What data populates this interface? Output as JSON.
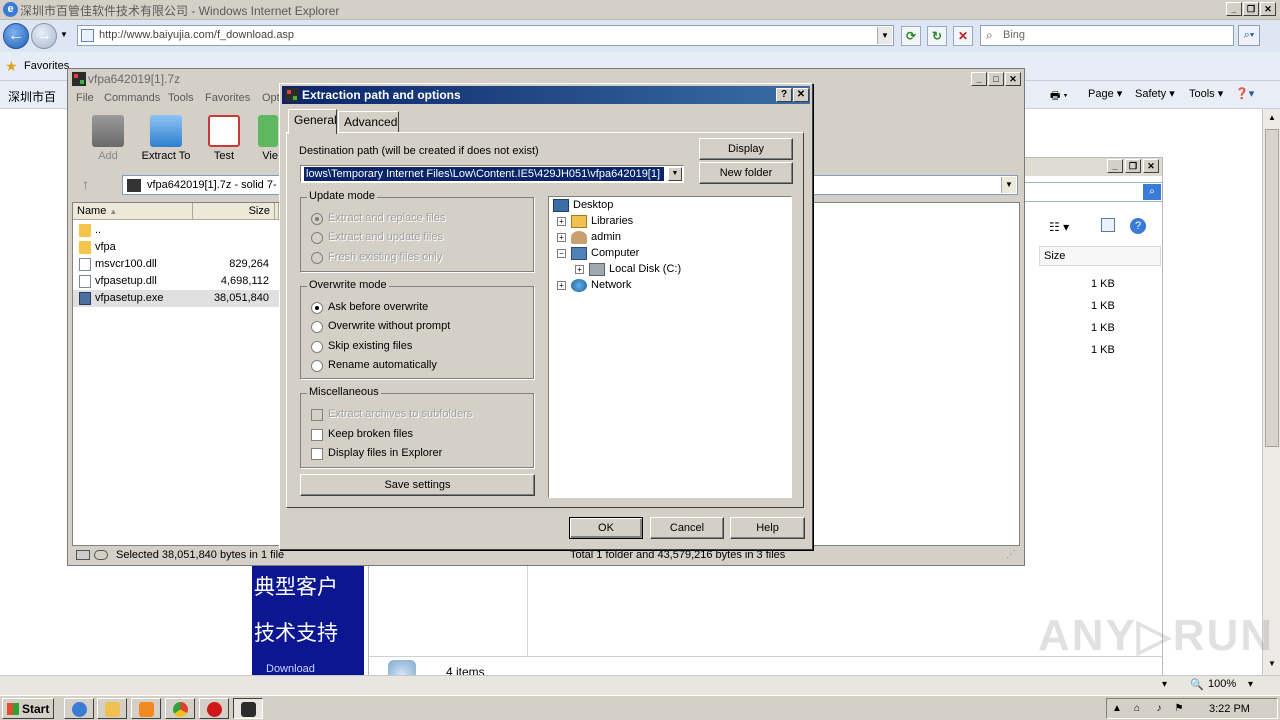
{
  "ie": {
    "title": "深圳市百管佳软件技术有限公司 - Windows Internet Explorer",
    "url": "http://www.baiyujia.com/f_download.asp",
    "search_placeholder": "Bing",
    "favorites_label": "Favorites",
    "page_tab_title": "深圳市百",
    "command_items": [
      "Page ▾",
      "Safety ▾",
      "Tools ▾"
    ],
    "zoom": "100%",
    "explorer": {
      "size_header": "Size",
      "sizes": [
        "1 KB",
        "1 KB",
        "1 KB",
        "1 KB"
      ],
      "items_count": "4 items"
    },
    "web_text": [
      "典型客户",
      "技术支持",
      "Download"
    ]
  },
  "zip": {
    "title": "vfpa642019[1].7z",
    "menu": [
      "File",
      "Commands",
      "Tools",
      "Favorites",
      "Opt"
    ],
    "toolbar": [
      {
        "label": "Add",
        "icon": "add-icon",
        "disabled": true
      },
      {
        "label": "Extract To",
        "icon": "extract-icon",
        "disabled": false
      },
      {
        "label": "Test",
        "icon": "test-icon",
        "disabled": false
      },
      {
        "label": "Vie",
        "icon": "view-icon",
        "disabled": false
      }
    ],
    "path": "vfpa642019[1].7z - solid 7-",
    "columns": {
      "name": "Name",
      "size": "Size"
    },
    "files": [
      {
        "name": "..",
        "size": "",
        "type": "folder"
      },
      {
        "name": "vfpa",
        "size": "",
        "type": "folder"
      },
      {
        "name": "msvcr100.dll",
        "size": "829,264",
        "type": "dll"
      },
      {
        "name": "vfpasetup.dll",
        "size": "4,698,112",
        "type": "dll"
      },
      {
        "name": "vfpasetup.exe",
        "size": "38,051,840",
        "type": "exe",
        "selected": true
      }
    ],
    "status_left": "Selected 38,051,840 bytes in 1 file",
    "status_right": "Total 1 folder and 43,579,216 bytes in 3 files"
  },
  "dialog": {
    "title": "Extraction path and options",
    "tabs": [
      "General",
      "Advanced"
    ],
    "dest_label": "Destination path (will be created if does not exist)",
    "dest_value": "lows\\Temporary Internet Files\\Low\\Content.IE5\\429JH051\\vfpa642019[1]",
    "display_btn": "Display",
    "new_folder_btn": "New folder",
    "update_mode": {
      "label": "Update mode",
      "options": [
        "Extract and replace files",
        "Extract and update files",
        "Fresh existing files only"
      ],
      "selected": 0
    },
    "overwrite_mode": {
      "label": "Overwrite mode",
      "options": [
        "Ask before overwrite",
        "Overwrite without prompt",
        "Skip existing files",
        "Rename automatically"
      ],
      "selected": 0
    },
    "misc": {
      "label": "Miscellaneous",
      "options": [
        "Extract archives to subfolders",
        "Keep broken files",
        "Display files in Explorer"
      ]
    },
    "save_settings": "Save settings",
    "tree": [
      "Desktop",
      "Libraries",
      "admin",
      "Computer",
      "Local Disk (C:)",
      "Network"
    ],
    "ok": "OK",
    "cancel": "Cancel",
    "help": "Help"
  },
  "taskbar": {
    "start": "Start",
    "clock": "3:22 PM"
  },
  "watermark": "ANY▷RUN"
}
